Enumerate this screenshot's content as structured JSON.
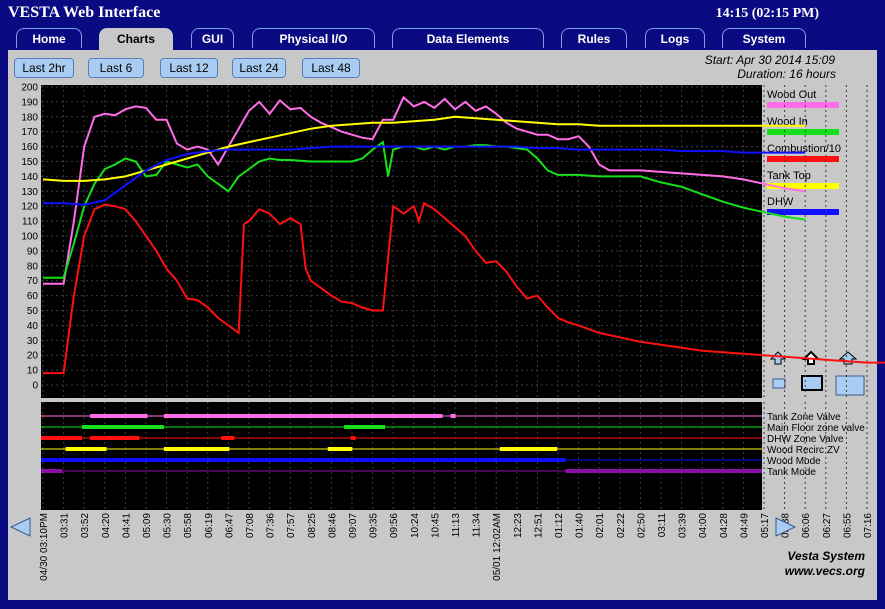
{
  "header": {
    "title": "VESTA Web Interface",
    "time": "14:15 (02:15 PM)"
  },
  "tabs": [
    {
      "label": "Home",
      "active": false
    },
    {
      "label": "Charts",
      "active": true
    },
    {
      "label": "GUI",
      "active": false
    },
    {
      "label": "Physical I/O",
      "active": false
    },
    {
      "label": "Data Elements",
      "active": false
    },
    {
      "label": "Rules",
      "active": false
    },
    {
      "label": "Logs",
      "active": false
    },
    {
      "label": "System",
      "active": false
    }
  ],
  "range_buttons": [
    "Last 2hr",
    "Last 6",
    "Last 12",
    "Last 24",
    "Last 48"
  ],
  "info": {
    "start": "Start: Apr 30 2014 15:09",
    "duration": "Duration: 16 hours"
  },
  "footer": {
    "line1": "Vesta System",
    "line2": "www.vecs.org"
  },
  "chart_data": {
    "type": "line",
    "ylim": [
      0,
      200
    ],
    "y_ticks": [
      0,
      10,
      20,
      30,
      40,
      50,
      60,
      70,
      80,
      90,
      100,
      110,
      120,
      130,
      140,
      150,
      160,
      170,
      180,
      190,
      200
    ],
    "x_tick_labels": [
      "04/30 03:10PM",
      "03:31",
      "03:52",
      "04:20",
      "04:41",
      "05:09",
      "05:30",
      "05:58",
      "06:19",
      "06:47",
      "07:08",
      "07:36",
      "07:57",
      "08:25",
      "08:46",
      "09:07",
      "09:35",
      "09:56",
      "10:24",
      "10:45",
      "11:13",
      "11:34",
      "05/01 12:02AM",
      "12:23",
      "12:51",
      "01:12",
      "01:40",
      "02:01",
      "02:22",
      "02:50",
      "03:11",
      "03:39",
      "04:00",
      "04:28",
      "04:49",
      "05:17",
      "05:38",
      "06:06",
      "06:27",
      "06:55",
      "07:16"
    ],
    "series": [
      {
        "name": "Wood Out",
        "color": "#ff6ee8",
        "values": [
          [
            0,
            68
          ],
          [
            2,
            68
          ],
          [
            3,
            110
          ],
          [
            4,
            160
          ],
          [
            5,
            180
          ],
          [
            6,
            182
          ],
          [
            7,
            181
          ],
          [
            8,
            185
          ],
          [
            9,
            187
          ],
          [
            10,
            186
          ],
          [
            11,
            178
          ],
          [
            12,
            178
          ],
          [
            13,
            162
          ],
          [
            14,
            158
          ],
          [
            15,
            160
          ],
          [
            16,
            158
          ],
          [
            17,
            148
          ],
          [
            18,
            160
          ],
          [
            19,
            172
          ],
          [
            20,
            184
          ],
          [
            21,
            190
          ],
          [
            22,
            182
          ],
          [
            23,
            191
          ],
          [
            24,
            185
          ],
          [
            25,
            186
          ],
          [
            26,
            180
          ],
          [
            27,
            176
          ],
          [
            28,
            173
          ],
          [
            29,
            170
          ],
          [
            30,
            168
          ],
          [
            31,
            166
          ],
          [
            32,
            165
          ],
          [
            33,
            178
          ],
          [
            34,
            178
          ],
          [
            35,
            193
          ],
          [
            36,
            187
          ],
          [
            37,
            190
          ],
          [
            38,
            186
          ],
          [
            39,
            192
          ],
          [
            40,
            185
          ],
          [
            41,
            190
          ],
          [
            42,
            184
          ],
          [
            43,
            187
          ],
          [
            44,
            182
          ],
          [
            45,
            176
          ],
          [
            46,
            172
          ],
          [
            47,
            170
          ],
          [
            48,
            168
          ],
          [
            49,
            168
          ],
          [
            50,
            165
          ],
          [
            51,
            165
          ],
          [
            52,
            167
          ],
          [
            53,
            160
          ],
          [
            54,
            148
          ],
          [
            55,
            144
          ],
          [
            56,
            144
          ],
          [
            58,
            144
          ],
          [
            60,
            143
          ],
          [
            62,
            142
          ],
          [
            64,
            141
          ],
          [
            66,
            140
          ],
          [
            68,
            138
          ],
          [
            70,
            135
          ],
          [
            72,
            132
          ],
          [
            74,
            130
          ]
        ]
      },
      {
        "name": "Wood In",
        "color": "#16e01a",
        "values": [
          [
            0,
            72
          ],
          [
            2,
            72
          ],
          [
            3,
            95
          ],
          [
            4,
            120
          ],
          [
            5,
            135
          ],
          [
            6,
            145
          ],
          [
            7,
            148
          ],
          [
            8,
            152
          ],
          [
            9,
            150
          ],
          [
            10,
            140
          ],
          [
            11,
            141
          ],
          [
            12,
            150
          ],
          [
            13,
            148
          ],
          [
            14,
            146
          ],
          [
            15,
            148
          ],
          [
            16,
            140
          ],
          [
            17,
            135
          ],
          [
            18,
            130
          ],
          [
            19,
            140
          ],
          [
            20,
            145
          ],
          [
            21,
            150
          ],
          [
            22,
            152
          ],
          [
            23,
            151
          ],
          [
            24,
            151
          ],
          [
            26,
            150
          ],
          [
            28,
            150
          ],
          [
            30,
            150
          ],
          [
            31,
            152
          ],
          [
            32,
            158
          ],
          [
            33,
            163
          ],
          [
            33.5,
            140
          ],
          [
            34,
            158
          ],
          [
            35,
            160
          ],
          [
            36,
            160
          ],
          [
            37,
            158
          ],
          [
            38,
            160
          ],
          [
            39,
            158
          ],
          [
            40,
            160
          ],
          [
            41,
            160
          ],
          [
            42,
            161
          ],
          [
            43,
            161
          ],
          [
            44,
            160
          ],
          [
            45,
            160
          ],
          [
            46,
            159
          ],
          [
            47,
            158
          ],
          [
            48,
            152
          ],
          [
            49,
            144
          ],
          [
            50,
            141
          ],
          [
            52,
            141
          ],
          [
            54,
            140
          ],
          [
            56,
            140
          ],
          [
            58,
            140
          ],
          [
            60,
            136
          ],
          [
            62,
            133
          ],
          [
            64,
            128
          ],
          [
            66,
            123
          ],
          [
            68,
            119
          ],
          [
            70,
            116
          ],
          [
            72,
            113
          ],
          [
            74,
            111
          ]
        ]
      },
      {
        "name": "Combustion/10",
        "color": "#ff1010",
        "values": [
          [
            0,
            8
          ],
          [
            2,
            8
          ],
          [
            3,
            60
          ],
          [
            4,
            100
          ],
          [
            5,
            118
          ],
          [
            6,
            121
          ],
          [
            7,
            120
          ],
          [
            8,
            118
          ],
          [
            9,
            110
          ],
          [
            10,
            100
          ],
          [
            11,
            90
          ],
          [
            12,
            78
          ],
          [
            13,
            70
          ],
          [
            14,
            58
          ],
          [
            15,
            57
          ],
          [
            16,
            52
          ],
          [
            17,
            45
          ],
          [
            18,
            40
          ],
          [
            19,
            35
          ],
          [
            19.5,
            108
          ],
          [
            20,
            110
          ],
          [
            21,
            118
          ],
          [
            22,
            115
          ],
          [
            23,
            108
          ],
          [
            24,
            112
          ],
          [
            25,
            108
          ],
          [
            25.5,
            78
          ],
          [
            26,
            70
          ],
          [
            27,
            65
          ],
          [
            28,
            60
          ],
          [
            29,
            56
          ],
          [
            30,
            55
          ],
          [
            31,
            52
          ],
          [
            32,
            50
          ],
          [
            33,
            50
          ],
          [
            34,
            120
          ],
          [
            35,
            115
          ],
          [
            36,
            120
          ],
          [
            36.5,
            110
          ],
          [
            37,
            122
          ],
          [
            38,
            118
          ],
          [
            39,
            112
          ],
          [
            40,
            106
          ],
          [
            41,
            100
          ],
          [
            42,
            90
          ],
          [
            43,
            82
          ],
          [
            44,
            83
          ],
          [
            45,
            76
          ],
          [
            46,
            66
          ],
          [
            47,
            58
          ],
          [
            48,
            60
          ],
          [
            49,
            52
          ],
          [
            50,
            45
          ],
          [
            51,
            42
          ],
          [
            52,
            40
          ],
          [
            54,
            35
          ],
          [
            56,
            32
          ],
          [
            58,
            29
          ],
          [
            60,
            27
          ],
          [
            62,
            25
          ],
          [
            64,
            23
          ],
          [
            66,
            22
          ],
          [
            68,
            21
          ],
          [
            70,
            20
          ],
          [
            72,
            19
          ],
          [
            74,
            18
          ],
          [
            76,
            17
          ],
          [
            78,
            16
          ],
          [
            80,
            15
          ],
          [
            82,
            15
          ],
          [
            84,
            15
          ],
          [
            86,
            15
          ],
          [
            88,
            15
          ],
          [
            90,
            15
          ],
          [
            92,
            15
          ]
        ]
      },
      {
        "name": "Tank Top",
        "color": "#ffff00",
        "values": [
          [
            0,
            138
          ],
          [
            2,
            137
          ],
          [
            4,
            137
          ],
          [
            6,
            138
          ],
          [
            8,
            140
          ],
          [
            10,
            144
          ],
          [
            12,
            148
          ],
          [
            14,
            152
          ],
          [
            16,
            156
          ],
          [
            18,
            160
          ],
          [
            20,
            163
          ],
          [
            22,
            166
          ],
          [
            24,
            169
          ],
          [
            26,
            172
          ],
          [
            28,
            174
          ],
          [
            30,
            175
          ],
          [
            32,
            176
          ],
          [
            34,
            176
          ],
          [
            36,
            177
          ],
          [
            38,
            178
          ],
          [
            40,
            180
          ],
          [
            42,
            179
          ],
          [
            44,
            178
          ],
          [
            46,
            177
          ],
          [
            48,
            176
          ],
          [
            50,
            175
          ],
          [
            52,
            175
          ],
          [
            54,
            174
          ],
          [
            56,
            174
          ],
          [
            58,
            174
          ],
          [
            60,
            174
          ],
          [
            62,
            174
          ],
          [
            64,
            174
          ],
          [
            66,
            174
          ],
          [
            68,
            174
          ],
          [
            70,
            174
          ],
          [
            72,
            174
          ],
          [
            74,
            174
          ]
        ]
      },
      {
        "name": "DHW",
        "color": "#1010ff",
        "values": [
          [
            0,
            122
          ],
          [
            2,
            122
          ],
          [
            4,
            121
          ],
          [
            6,
            124
          ],
          [
            8,
            134
          ],
          [
            10,
            144
          ],
          [
            12,
            151
          ],
          [
            14,
            155
          ],
          [
            16,
            157
          ],
          [
            18,
            158
          ],
          [
            20,
            158
          ],
          [
            22,
            158
          ],
          [
            24,
            158
          ],
          [
            26,
            159
          ],
          [
            28,
            160
          ],
          [
            30,
            160
          ],
          [
            32,
            160
          ],
          [
            34,
            160
          ],
          [
            36,
            160
          ],
          [
            38,
            160
          ],
          [
            40,
            160
          ],
          [
            42,
            160
          ],
          [
            44,
            160
          ],
          [
            46,
            160
          ],
          [
            48,
            159
          ],
          [
            50,
            159
          ],
          [
            52,
            158
          ],
          [
            54,
            158
          ],
          [
            56,
            158
          ],
          [
            58,
            158
          ],
          [
            60,
            158
          ],
          [
            62,
            157
          ],
          [
            64,
            157
          ],
          [
            66,
            157
          ],
          [
            68,
            156
          ],
          [
            70,
            156
          ],
          [
            72,
            156
          ],
          [
            74,
            156
          ]
        ]
      }
    ],
    "state_series": [
      {
        "name": "Tank Zone Valve",
        "color": "#ff6ee8",
        "segments": [
          [
            3,
            6.5
          ],
          [
            7.5,
            24.5
          ],
          [
            25,
            25.3
          ]
        ]
      },
      {
        "name": "Main Floor zone valve",
        "color": "#16e01a",
        "segments": [
          [
            2.5,
            7.5
          ],
          [
            18.5,
            21
          ]
        ]
      },
      {
        "name": "DHW Zone Valve",
        "color": "#ff1010",
        "segments": [
          [
            0,
            2.5
          ],
          [
            3,
            6
          ],
          [
            11,
            11.8
          ],
          [
            18.9,
            19.2
          ]
        ]
      },
      {
        "name": "Wood Recirc ZV",
        "color": "#ffff00",
        "segments": [
          [
            1.5,
            4
          ],
          [
            7.5,
            11.5
          ],
          [
            17.5,
            19
          ],
          [
            28,
            31.5
          ]
        ]
      },
      {
        "name": "Wood Mode",
        "color": "#1010ff",
        "segments": [
          [
            0,
            32
          ]
        ]
      },
      {
        "name": "Tank Mode",
        "color": "#8a0ea8",
        "segments": [
          [
            0,
            1.3
          ],
          [
            32,
            44
          ]
        ]
      }
    ],
    "state_x_range": [
      0,
      44
    ]
  }
}
